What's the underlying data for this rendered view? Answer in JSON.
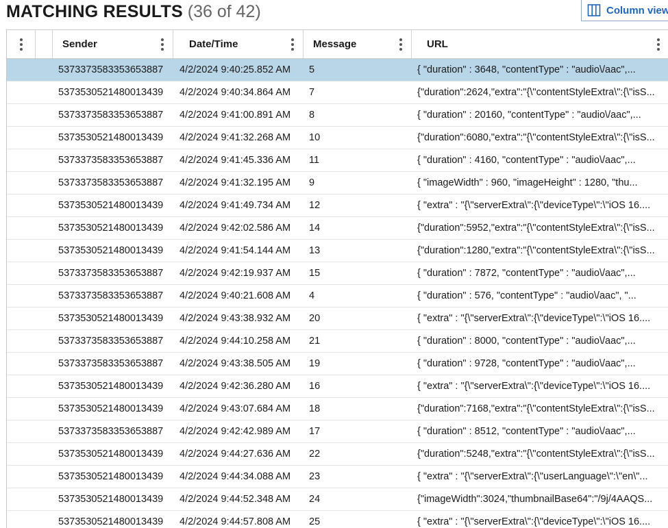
{
  "header": {
    "title": "MATCHING RESULTS",
    "count": "(36 of 42)",
    "column_view_label": "Column view"
  },
  "colors": {
    "selected_row": "#b9d5e8",
    "accent": "#1f66b8"
  },
  "table": {
    "columns": [
      "Sender",
      "Date/Time",
      "Message",
      "URL"
    ],
    "selected_row_index": 0,
    "rows": [
      {
        "sender": "5373373583353653887",
        "datetime": "4/2/2024 9:40:25.852 AM",
        "message": "5",
        "url": "{   \"duration\" : 3648,   \"contentType\" : \"audio\\/aac\",..."
      },
      {
        "sender": "5373530521480013439",
        "datetime": "4/2/2024 9:40:34.864 AM",
        "message": "7",
        "url": "{\"duration\":2624,\"extra\":\"{\\\"contentStyleExtra\\\":{\\\"isS..."
      },
      {
        "sender": "5373373583353653887",
        "datetime": "4/2/2024 9:41:00.891 AM",
        "message": "8",
        "url": "{   \"duration\" : 20160,   \"contentType\" : \"audio\\/aac\",..."
      },
      {
        "sender": "5373530521480013439",
        "datetime": "4/2/2024 9:41:32.268 AM",
        "message": "10",
        "url": "{\"duration\":6080,\"extra\":\"{\\\"contentStyleExtra\\\":{\\\"isS..."
      },
      {
        "sender": "5373373583353653887",
        "datetime": "4/2/2024 9:41:45.336 AM",
        "message": "11",
        "url": "{   \"duration\" : 4160,   \"contentType\" : \"audio\\/aac\",..."
      },
      {
        "sender": "5373373583353653887",
        "datetime": "4/2/2024 9:41:32.195 AM",
        "message": "9",
        "url": "{   \"imageWidth\" : 960,   \"imageHeight\" : 1280,   \"thu..."
      },
      {
        "sender": "5373530521480013439",
        "datetime": "4/2/2024 9:41:49.734 AM",
        "message": "12",
        "url": "{   \"extra\" : \"{\\\"serverExtra\\\":{\\\"deviceType\\\":\\\"iOS 16...."
      },
      {
        "sender": "5373530521480013439",
        "datetime": "4/2/2024 9:42:02.586 AM",
        "message": "14",
        "url": "{\"duration\":5952,\"extra\":\"{\\\"contentStyleExtra\\\":{\\\"isS..."
      },
      {
        "sender": "5373530521480013439",
        "datetime": "4/2/2024 9:41:54.144 AM",
        "message": "13",
        "url": "{\"duration\":1280,\"extra\":\"{\\\"contentStyleExtra\\\":{\\\"isS..."
      },
      {
        "sender": "5373373583353653887",
        "datetime": "4/2/2024 9:42:19.937 AM",
        "message": "15",
        "url": "{   \"duration\" : 7872,   \"contentType\" : \"audio\\/aac\",..."
      },
      {
        "sender": "5373373583353653887",
        "datetime": "4/2/2024 9:40:21.608 AM",
        "message": "4",
        "url": "{   \"duration\" : 576,   \"contentType\" : \"audio\\/aac\",   \"..."
      },
      {
        "sender": "5373530521480013439",
        "datetime": "4/2/2024 9:43:38.932 AM",
        "message": "20",
        "url": "{   \"extra\" : \"{\\\"serverExtra\\\":{\\\"deviceType\\\":\\\"iOS 16...."
      },
      {
        "sender": "5373373583353653887",
        "datetime": "4/2/2024 9:44:10.258 AM",
        "message": "21",
        "url": "{   \"duration\" : 8000,   \"contentType\" : \"audio\\/aac\",..."
      },
      {
        "sender": "5373373583353653887",
        "datetime": "4/2/2024 9:43:38.505 AM",
        "message": "19",
        "url": "{   \"duration\" : 9728,   \"contentType\" : \"audio\\/aac\",..."
      },
      {
        "sender": "5373530521480013439",
        "datetime": "4/2/2024 9:42:36.280 AM",
        "message": "16",
        "url": "{   \"extra\" : \"{\\\"serverExtra\\\":{\\\"deviceType\\\":\\\"iOS 16...."
      },
      {
        "sender": "5373530521480013439",
        "datetime": "4/2/2024 9:43:07.684 AM",
        "message": "18",
        "url": "{\"duration\":7168,\"extra\":\"{\\\"contentStyleExtra\\\":{\\\"isS..."
      },
      {
        "sender": "5373373583353653887",
        "datetime": "4/2/2024 9:42:42.989 AM",
        "message": "17",
        "url": "{   \"duration\" : 8512,   \"contentType\" : \"audio\\/aac\",..."
      },
      {
        "sender": "5373530521480013439",
        "datetime": "4/2/2024 9:44:27.636 AM",
        "message": "22",
        "url": "{\"duration\":5248,\"extra\":\"{\\\"contentStyleExtra\\\":{\\\"isS..."
      },
      {
        "sender": "5373530521480013439",
        "datetime": "4/2/2024 9:44:34.088 AM",
        "message": "23",
        "url": "{   \"extra\" : \"{\\\"serverExtra\\\":{\\\"userLanguage\\\":\\\"en\\\"..."
      },
      {
        "sender": "5373530521480013439",
        "datetime": "4/2/2024 9:44:52.348 AM",
        "message": "24",
        "url": "{\"imageWidth\":3024,\"thumbnailBase64\":\"/9j/4AAQS..."
      },
      {
        "sender": "5373530521480013439",
        "datetime": "4/2/2024 9:44:57.808 AM",
        "message": "25",
        "url": "{   \"extra\" : \"{\\\"serverExtra\\\":{\\\"deviceType\\\":\\\"iOS 16...."
      }
    ]
  }
}
